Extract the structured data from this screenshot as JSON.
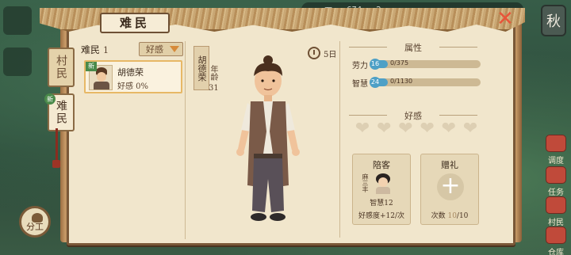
{
  "hud": {
    "res1": "117万",
    "res2": "674",
    "res3": "2",
    "season": "秋"
  },
  "tabs": {
    "villager": "村民",
    "refugee": "难民",
    "new_badge": "新"
  },
  "panel": {
    "title": "难民"
  },
  "list": {
    "header_label": "难民",
    "count": "1",
    "sort_label": "好感",
    "items": [
      {
        "new_badge": "新",
        "name": "胡德荣",
        "affinity": "好感 0%"
      }
    ]
  },
  "profile": {
    "name": "胡德荣",
    "age_label": "年龄",
    "age": "31",
    "days": "5日"
  },
  "attributes": {
    "title": "属性",
    "rows": [
      {
        "label": "劳力",
        "level": "16",
        "value": "0/375",
        "progress": 0.0
      },
      {
        "label": "智慧",
        "level": "24",
        "value": "0/1130",
        "progress": 0.0
      }
    ]
  },
  "affection": {
    "title": "好感",
    "hearts_total": 6,
    "hearts_filled": 0
  },
  "guest": {
    "title": "陪客",
    "name": "麻三丰",
    "intel": "智慧12",
    "bonus": "好感度+12/次"
  },
  "gift": {
    "title": "赠礼",
    "count_prefix": "次数",
    "count_used": "10",
    "count_total": "/10"
  },
  "right_menu": [
    "调度",
    "任务",
    "村民",
    "仓库"
  ],
  "bottom_button": "分工",
  "colors": {
    "panel_bg": "#f1e6cc",
    "frame": "#7a5838",
    "accent_blue": "#4ea0c6",
    "highlight_gold": "#e7b866",
    "close_red": "#e8553a"
  }
}
